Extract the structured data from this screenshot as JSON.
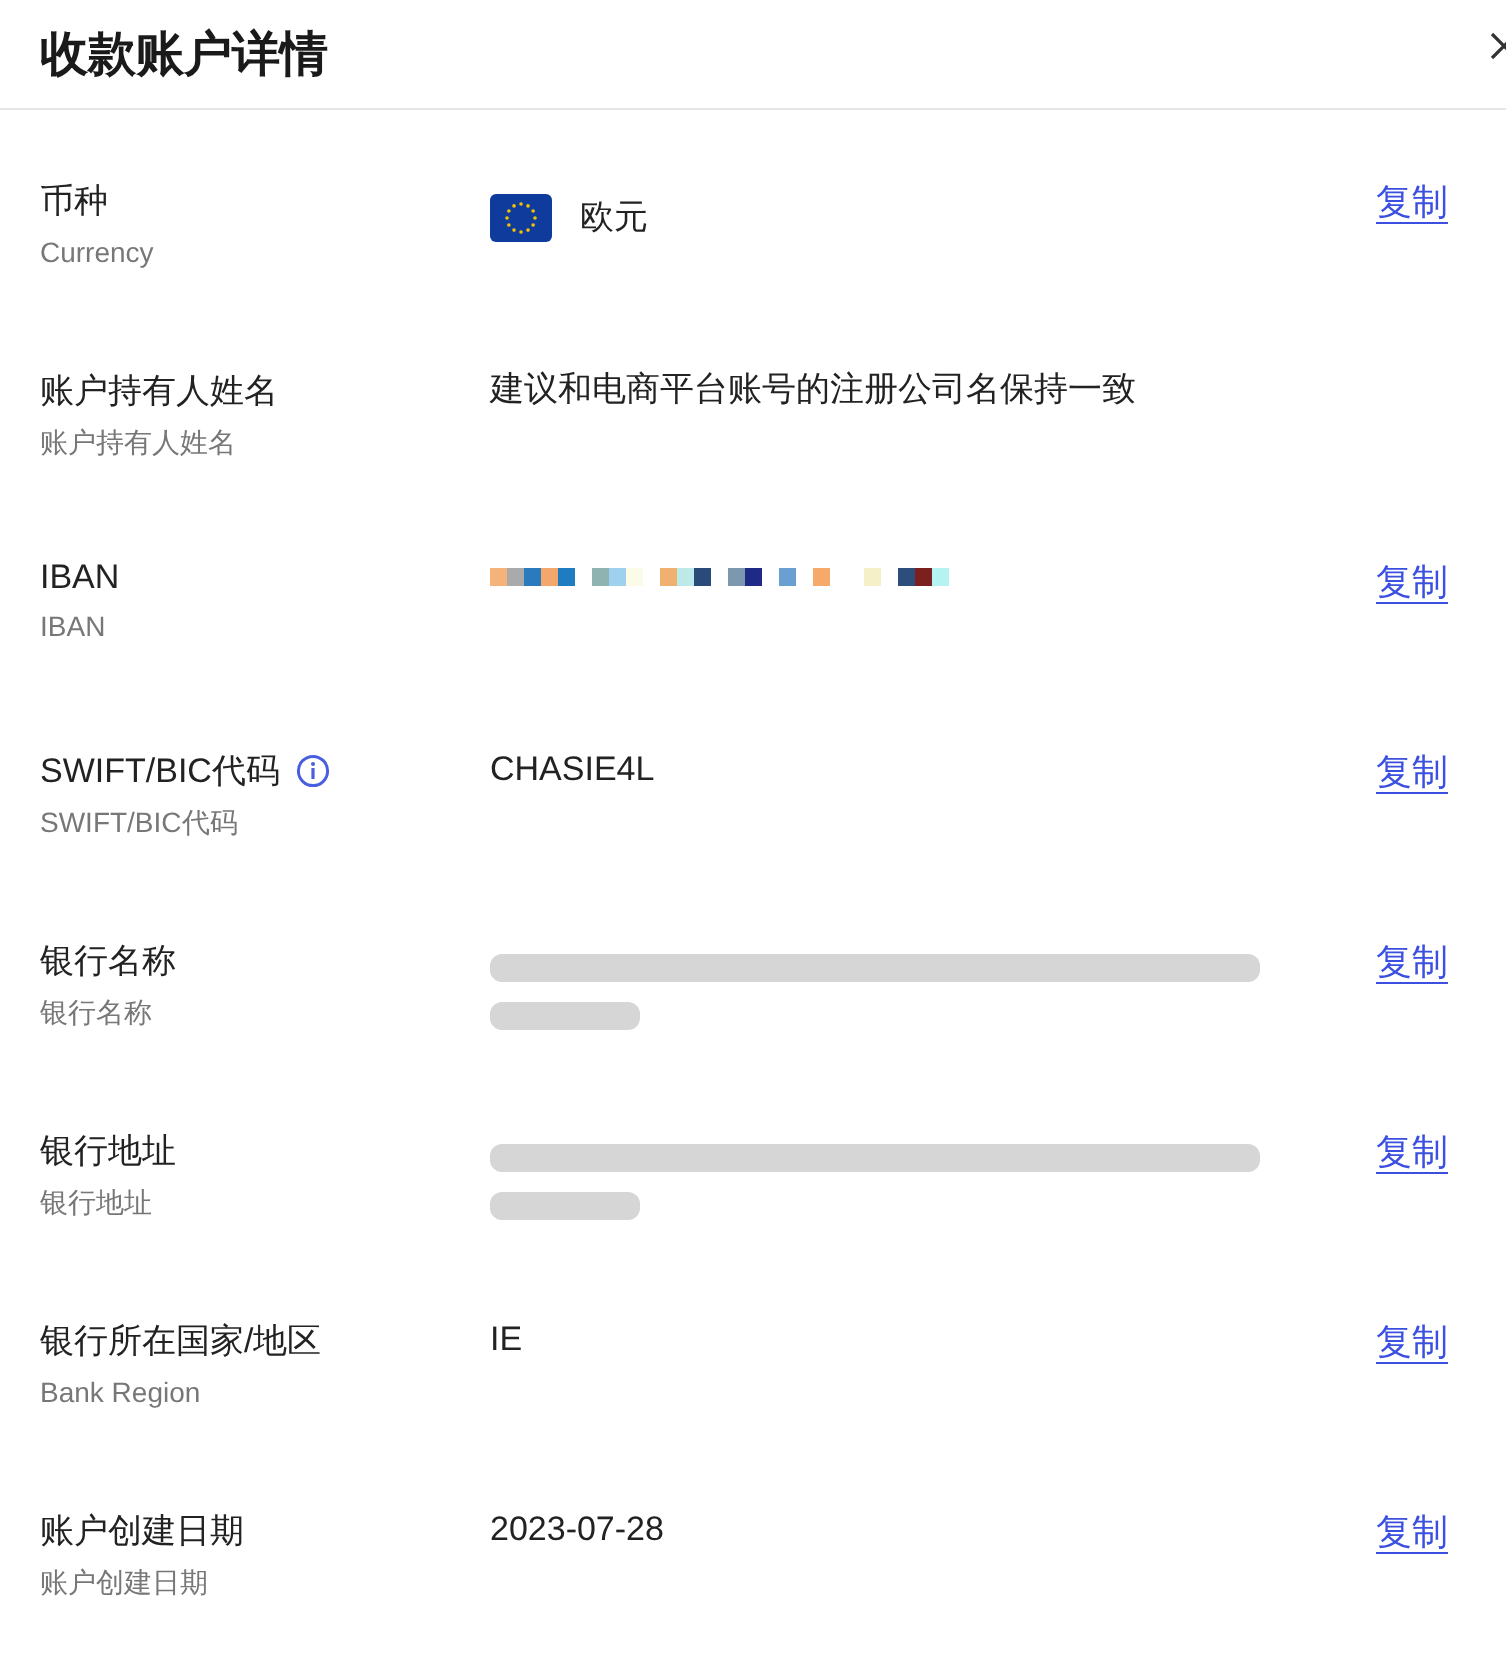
{
  "title": "收款账户详情",
  "fields": [
    {
      "label": "币种",
      "sublabel": "Currency",
      "kind": "currency",
      "value": "欧元",
      "action": "复制"
    },
    {
      "label": "账户持有人姓名",
      "sublabel": "账户持有人姓名",
      "kind": "text",
      "value": "建议和电商平台账号的注册公司名保持一致"
    },
    {
      "label": "IBAN",
      "sublabel": "IBAN",
      "kind": "pixelated",
      "action": "复制"
    },
    {
      "label": "SWIFT/BIC代码",
      "sublabel": "SWIFT/BIC代码",
      "kind": "text",
      "value": "CHASIE4L",
      "info": true,
      "action": "复制"
    },
    {
      "label": "银行名称",
      "sublabel": "银行名称",
      "kind": "blurred",
      "action": "复制"
    },
    {
      "label": "银行地址",
      "sublabel": "银行地址",
      "kind": "blurred",
      "action": "复制"
    },
    {
      "label": "银行所在国家/地区",
      "sublabel": "Bank Region",
      "kind": "text",
      "value": "IE",
      "action": "复制"
    },
    {
      "label": "账户创建日期",
      "sublabel": "账户创建日期",
      "kind": "text",
      "value": "2023-07-28",
      "action": "复制"
    }
  ]
}
